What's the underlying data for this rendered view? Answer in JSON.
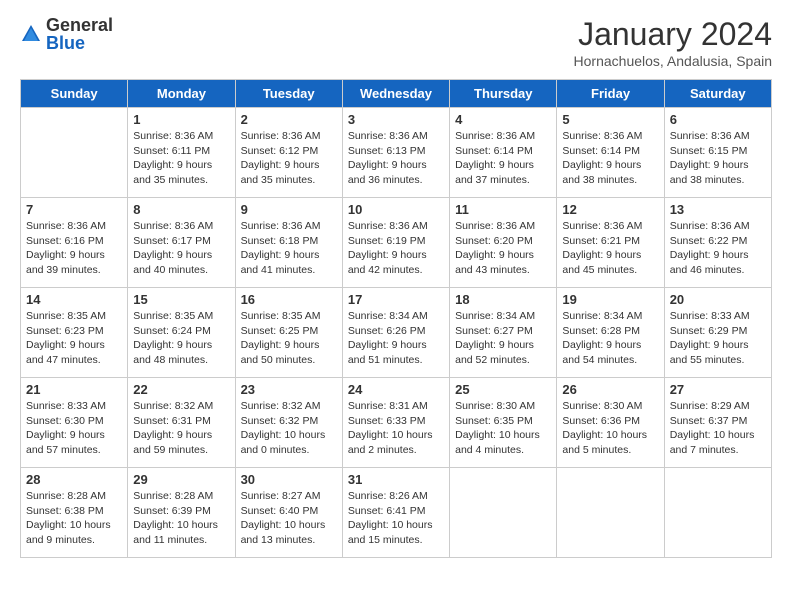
{
  "header": {
    "logo_general": "General",
    "logo_blue": "Blue",
    "title": "January 2024",
    "subtitle": "Hornachuelos, Andalusia, Spain"
  },
  "columns": [
    "Sunday",
    "Monday",
    "Tuesday",
    "Wednesday",
    "Thursday",
    "Friday",
    "Saturday"
  ],
  "weeks": [
    [
      {
        "day": "",
        "info": ""
      },
      {
        "day": "1",
        "info": "Sunrise: 8:36 AM\nSunset: 6:11 PM\nDaylight: 9 hours\nand 35 minutes."
      },
      {
        "day": "2",
        "info": "Sunrise: 8:36 AM\nSunset: 6:12 PM\nDaylight: 9 hours\nand 35 minutes."
      },
      {
        "day": "3",
        "info": "Sunrise: 8:36 AM\nSunset: 6:13 PM\nDaylight: 9 hours\nand 36 minutes."
      },
      {
        "day": "4",
        "info": "Sunrise: 8:36 AM\nSunset: 6:14 PM\nDaylight: 9 hours\nand 37 minutes."
      },
      {
        "day": "5",
        "info": "Sunrise: 8:36 AM\nSunset: 6:14 PM\nDaylight: 9 hours\nand 38 minutes."
      },
      {
        "day": "6",
        "info": "Sunrise: 8:36 AM\nSunset: 6:15 PM\nDaylight: 9 hours\nand 38 minutes."
      }
    ],
    [
      {
        "day": "7",
        "info": ""
      },
      {
        "day": "8",
        "info": "Sunrise: 8:36 AM\nSunset: 6:17 PM\nDaylight: 9 hours\nand 40 minutes."
      },
      {
        "day": "9",
        "info": "Sunrise: 8:36 AM\nSunset: 6:18 PM\nDaylight: 9 hours\nand 41 minutes."
      },
      {
        "day": "10",
        "info": "Sunrise: 8:36 AM\nSunset: 6:19 PM\nDaylight: 9 hours\nand 42 minutes."
      },
      {
        "day": "11",
        "info": "Sunrise: 8:36 AM\nSunset: 6:20 PM\nDaylight: 9 hours\nand 43 minutes."
      },
      {
        "day": "12",
        "info": "Sunrise: 8:36 AM\nSunset: 6:21 PM\nDaylight: 9 hours\nand 45 minutes."
      },
      {
        "day": "13",
        "info": "Sunrise: 8:36 AM\nSunset: 6:22 PM\nDaylight: 9 hours\nand 46 minutes."
      }
    ],
    [
      {
        "day": "14",
        "info": ""
      },
      {
        "day": "15",
        "info": "Sunrise: 8:35 AM\nSunset: 6:24 PM\nDaylight: 9 hours\nand 48 minutes."
      },
      {
        "day": "16",
        "info": "Sunrise: 8:35 AM\nSunset: 6:25 PM\nDaylight: 9 hours\nand 50 minutes."
      },
      {
        "day": "17",
        "info": "Sunrise: 8:34 AM\nSunset: 6:26 PM\nDaylight: 9 hours\nand 51 minutes."
      },
      {
        "day": "18",
        "info": "Sunrise: 8:34 AM\nSunset: 6:27 PM\nDaylight: 9 hours\nand 52 minutes."
      },
      {
        "day": "19",
        "info": "Sunrise: 8:34 AM\nSunset: 6:28 PM\nDaylight: 9 hours\nand 54 minutes."
      },
      {
        "day": "20",
        "info": "Sunrise: 8:33 AM\nSunset: 6:29 PM\nDaylight: 9 hours\nand 55 minutes."
      }
    ],
    [
      {
        "day": "21",
        "info": ""
      },
      {
        "day": "22",
        "info": "Sunrise: 8:32 AM\nSunset: 6:31 PM\nDaylight: 9 hours\nand 59 minutes."
      },
      {
        "day": "23",
        "info": "Sunrise: 8:32 AM\nSunset: 6:32 PM\nDaylight: 10 hours\nand 0 minutes."
      },
      {
        "day": "24",
        "info": "Sunrise: 8:31 AM\nSunset: 6:33 PM\nDaylight: 10 hours\nand 2 minutes."
      },
      {
        "day": "25",
        "info": "Sunrise: 8:30 AM\nSunset: 6:35 PM\nDaylight: 10 hours\nand 4 minutes."
      },
      {
        "day": "26",
        "info": "Sunrise: 8:30 AM\nSunset: 6:36 PM\nDaylight: 10 hours\nand 5 minutes."
      },
      {
        "day": "27",
        "info": "Sunrise: 8:29 AM\nSunset: 6:37 PM\nDaylight: 10 hours\nand 7 minutes."
      }
    ],
    [
      {
        "day": "28",
        "info": "Sunrise: 8:28 AM\nSunset: 6:38 PM\nDaylight: 10 hours\nand 9 minutes."
      },
      {
        "day": "29",
        "info": "Sunrise: 8:28 AM\nSunset: 6:39 PM\nDaylight: 10 hours\nand 11 minutes."
      },
      {
        "day": "30",
        "info": "Sunrise: 8:27 AM\nSunset: 6:40 PM\nDaylight: 10 hours\nand 13 minutes."
      },
      {
        "day": "31",
        "info": "Sunrise: 8:26 AM\nSunset: 6:41 PM\nDaylight: 10 hours\nand 15 minutes."
      },
      {
        "day": "",
        "info": ""
      },
      {
        "day": "",
        "info": ""
      },
      {
        "day": "",
        "info": ""
      }
    ]
  ],
  "week1_sun_info": "Sunrise: 8:36 AM\nSunset: 6:16 PM\nDaylight: 9 hours\nand 39 minutes.",
  "week2_sun_info": "Sunrise: 8:36 AM\nSunset: 6:16 PM\nDaylight: 9 hours\nand 39 minutes.",
  "week3_sun_info": "Sunrise: 8:35 AM\nSunset: 6:23 PM\nDaylight: 9 hours\nand 47 minutes.",
  "week4_sun_info": "Sunrise: 8:33 AM\nSunset: 6:30 PM\nDaylight: 9 hours\nand 57 minutes."
}
